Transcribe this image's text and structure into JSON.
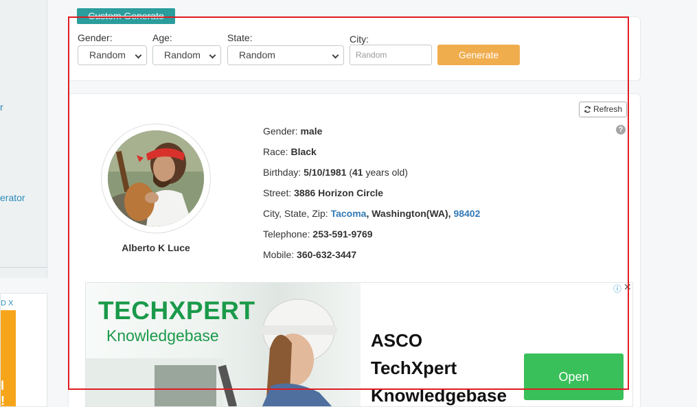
{
  "sidebar": {
    "link_1": "r",
    "link_2": "erator",
    "ad_controls": "D X",
    "ad_glyphs": [
      "l",
      "!"
    ]
  },
  "form": {
    "title": "Custom Generate",
    "gender": {
      "label": "Gender:",
      "value": "Random"
    },
    "age": {
      "label": "Age:",
      "value": "Random"
    },
    "state": {
      "label": "State:",
      "value": "Random"
    },
    "city": {
      "label": "City:",
      "placeholder": "Random"
    },
    "generate_label": "Generate"
  },
  "result": {
    "refresh_label": "Refresh",
    "help_glyph": "?",
    "name": "Alberto K Luce",
    "fields": {
      "gender_label": "Gender:",
      "gender": "male",
      "race_label": "Race:",
      "race": "Black",
      "birthday_label": "Birthday:",
      "birthday": "5/10/1981",
      "age": "41",
      "age_suffix": "years old)",
      "street_label": "Street:",
      "street": "3886 Horizon Circle",
      "csz_label": "City, State, Zip:",
      "city": "Tacoma",
      "state": "Washington(WA)",
      "zip": "98402",
      "telephone_label": "Telephone:",
      "telephone": "253-591-9769",
      "mobile_label": "Mobile:",
      "mobile": "360-632-3447"
    }
  },
  "ad": {
    "logo_line1": "TECHXPERT",
    "logo_line2": "Knowledgebase",
    "headline": [
      "ASCO",
      "TechXpert",
      "Knowledgebase"
    ],
    "cta": "Open",
    "info_glyph": "ⓘ",
    "close_glyph": "✕"
  },
  "colors": {
    "accent_teal": "#2a9d9c",
    "generate_orange": "#f0ad4e",
    "link_blue": "#337ab7",
    "ad_green": "#3ac05a",
    "highlight_red": "#e01b22"
  }
}
